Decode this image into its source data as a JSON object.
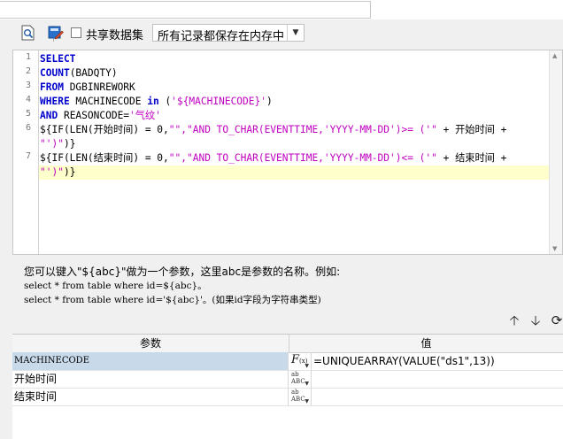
{
  "toolbar": {
    "share_dataset_label": "共享数据集",
    "share_dataset_checked": false,
    "storage_mode": "所有记录都保存在内存中"
  },
  "editor": {
    "line_numbers": [
      "1",
      "2",
      "3",
      "4",
      "5",
      "6",
      "7"
    ],
    "lines": {
      "l1": {
        "kw": "SELECT"
      },
      "l2": {
        "fn": "COUNT",
        "rest": "(BADQTY)"
      },
      "l3": {
        "kw": "FROM",
        "rest": " DGBINREWORK"
      },
      "l4": {
        "kw": "WHERE",
        "mid": " MACHINECODE ",
        "kw2": "in",
        "paren": " (",
        "str": "'${MACHINECODE}'",
        "close": ")"
      },
      "l5": {
        "kw": "AND",
        "mid": " REASONCODE=",
        "str": "'气纹'"
      },
      "l6": {
        "a": "${IF(LEN(开始时间) = 0,",
        "s1": "\"\",\"AND TO_CHAR(EVENTTIME,'YYYY-MM-DD')>= ('\"",
        "b": " + 开始时间 +",
        "wrap": "\"')\"",
        "end": ")}"
      },
      "l7": {
        "a": "${IF(LEN(结束时间) = 0,",
        "s1": "\"\",\"AND TO_CHAR(EVENTTIME,'YYYY-MM-DD')<= ('\"",
        "b": " + 结束时间 +",
        "wrap": "\"')\"",
        "end": ")}"
      }
    }
  },
  "hint": {
    "line1": "您可以键入\"${abc}\"做为一个参数，这里abc是参数的名称。例如:",
    "line2": "select * from table where id=${abc}。",
    "line3": "select * from table where id='${abc}'。(如果id字段为字符串类型)"
  },
  "params": {
    "header_name": "参数",
    "header_value": "值",
    "rows": [
      {
        "name": "MACHINECODE",
        "type": "formula",
        "value": "=UNIQUEARRAY(VALUE(\"ds1\",13))"
      },
      {
        "name": "开始时间",
        "type": "text",
        "value": ""
      },
      {
        "name": "结束时间",
        "type": "text",
        "value": ""
      }
    ]
  },
  "icons": {
    "preview": "search-document-icon",
    "properties": "edit-properties-icon",
    "move_up": "arrow-up-icon",
    "move_down": "arrow-down-icon",
    "refresh": "refresh-icon"
  }
}
